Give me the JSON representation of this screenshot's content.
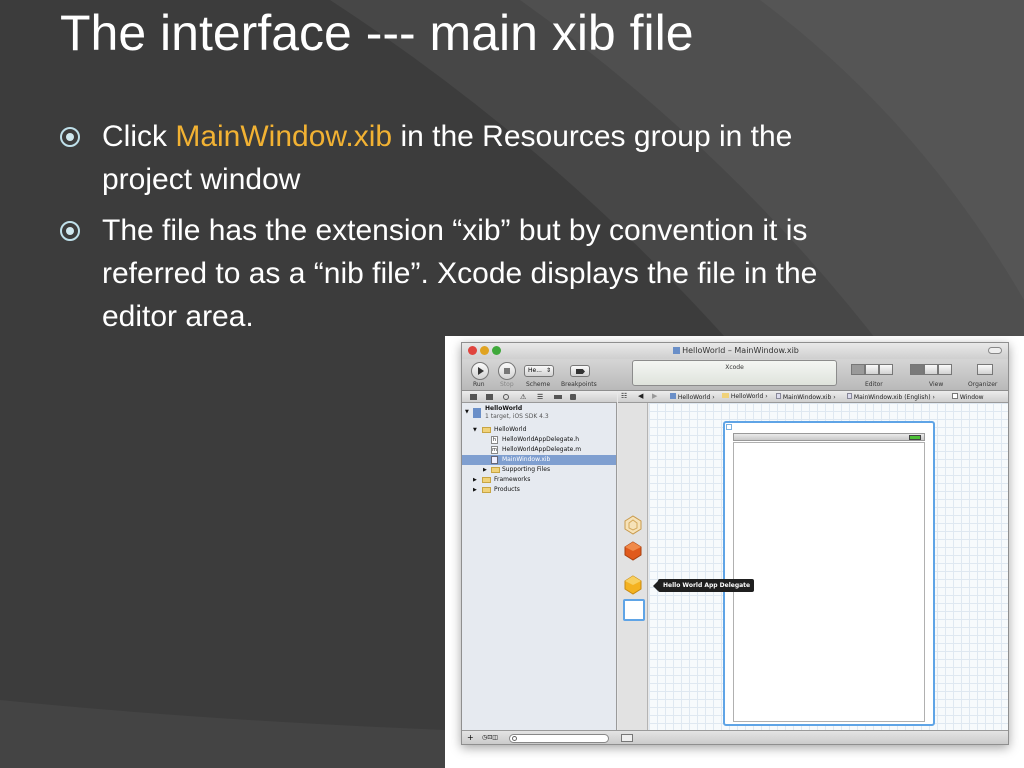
{
  "slide": {
    "title": "The interface --- main xib file",
    "bullets": [
      {
        "pre": "Click ",
        "highlight": "MainWindow.xib",
        "post": " in the Resources group in the project window"
      },
      {
        "text": "The file has the extension “xib” but by convention it is referred to as a “nib file”. Xcode displays the file in the editor area."
      }
    ]
  },
  "colors": {
    "highlight": "#f2b233",
    "background": "#3c3c3c",
    "canvas_view_border": "#5fa4e6",
    "selection": "#7f9fd0"
  },
  "xcode": {
    "window_title": "HelloWorld – MainWindow.xib",
    "activity_text": "Xcode",
    "scheme_label": "He...",
    "toolbar_labels": {
      "run": "Run",
      "stop": "Stop",
      "scheme": "Scheme",
      "breakpoints": "Breakpoints",
      "editor": "Editor",
      "view": "View",
      "organizer": "Organizer"
    },
    "jump_bar": {
      "crumbs": [
        "HelloWorld",
        "HelloWorld",
        "MainWindow.xib",
        "MainWindow.xib (English)",
        "Window"
      ]
    },
    "navigator": {
      "items": [
        {
          "label": "HelloWorld",
          "icon": "project-icon"
        },
        {
          "label": "1 target, iOS SDK 4.3",
          "icon": ""
        },
        {
          "label": "HelloWorld",
          "icon": "folder-icon"
        },
        {
          "label": "HelloWorldAppDelegate.h",
          "icon": "header-file-icon"
        },
        {
          "label": "HelloWorldAppDelegate.m",
          "icon": "source-file-icon"
        },
        {
          "label": "MainWindow.xib",
          "icon": "xib-file-icon"
        },
        {
          "label": "Supporting Files",
          "icon": "folder-icon"
        },
        {
          "label": "Frameworks",
          "icon": "folder-icon"
        },
        {
          "label": "Products",
          "icon": "folder-icon"
        }
      ]
    },
    "tooltip": "Hello World App Delegate"
  }
}
